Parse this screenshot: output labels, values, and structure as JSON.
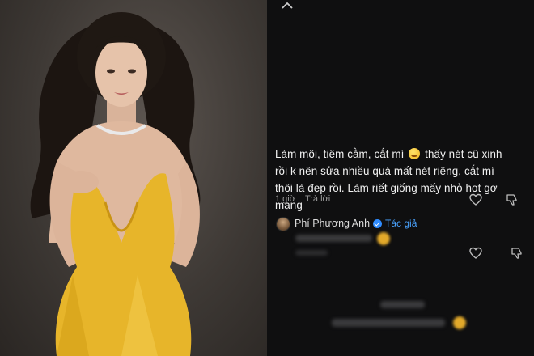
{
  "comment": {
    "line1_before_emoji": "Làm môi, tiêm cằm, cắt mí",
    "emoji_name": "shushing-face-emoji",
    "line1_after_emoji": "thấy nét cũ xinh rồi k nên sửa nhiều quá mất nét riêng, cắt mí thôi là đẹp rồi. Làm riết giống mấy nhỏ hot gơ mạng",
    "time": "1 giờ",
    "reply_label": "Trả lời"
  },
  "reply": {
    "author": "Phí Phương Anh",
    "author_tag": "Tác giả"
  },
  "icons": {
    "like": "heart-outline-icon",
    "dislike": "thumbs-down-outline-icon",
    "verified": "verified-badge-icon"
  },
  "colors": {
    "panel_bg": "#0f0f10",
    "accent": "#4aa3ff",
    "dress": "#e7b52a"
  }
}
